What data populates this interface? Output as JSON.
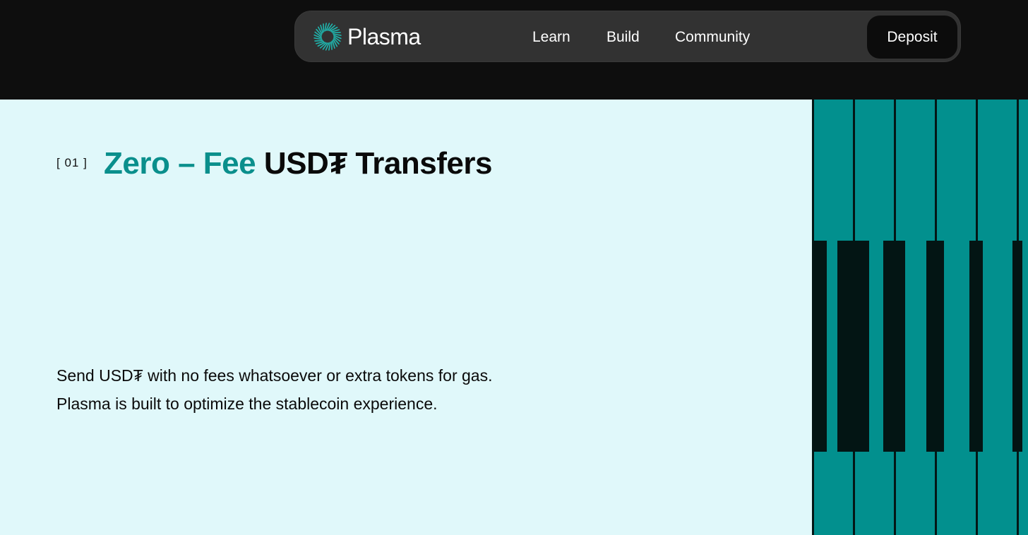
{
  "nav": {
    "brand": "Plasma",
    "links": [
      "Learn",
      "Build",
      "Community"
    ],
    "deposit_label": "Deposit"
  },
  "hero": {
    "index": "[ 01 ]",
    "headline_accent": "Zero – Fee",
    "headline_rest": " USD₮ Transfers",
    "body_line1": "Send USD₮ with no fees whatsoever or extra tokens for gas.",
    "body_line2": "Plasma is built to optimize the stablecoin experience."
  },
  "colors": {
    "background_dark": "#0e0e0e",
    "nav_pill": "#323232",
    "hero_bg": "#e0f8fa",
    "accent_teal": "#0a8f8c",
    "piano_teal": "#02908e",
    "piano_dark": "#031514"
  },
  "icons": {
    "logo": "plasma-logo-icon"
  }
}
